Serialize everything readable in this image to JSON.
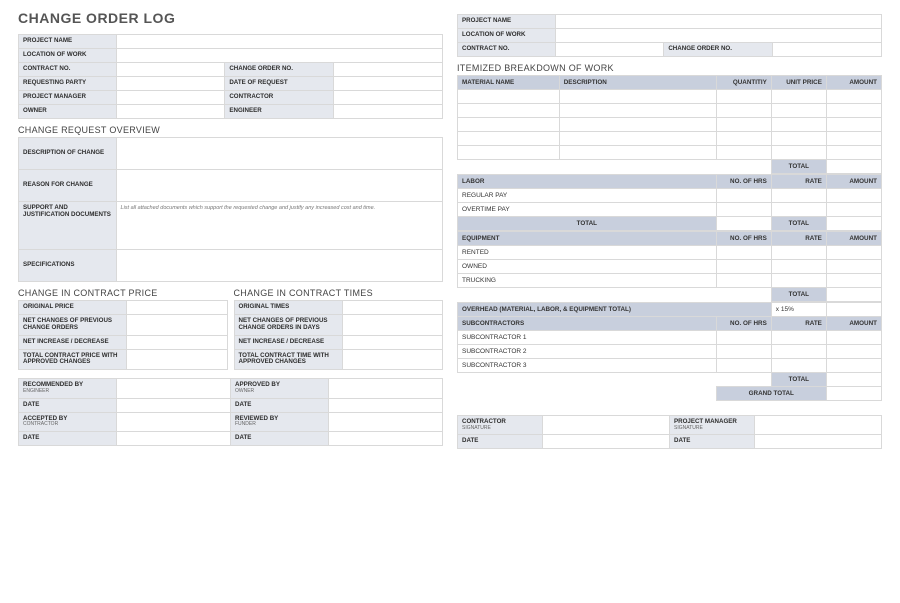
{
  "title": "CHANGE ORDER LOG",
  "left": {
    "info": {
      "project_name": "PROJECT NAME",
      "location_of_work": "LOCATION OF WORK",
      "contract_no": "CONTRACT NO.",
      "change_order_no": "CHANGE ORDER NO.",
      "requesting_party": "REQUESTING PARTY",
      "date_of_request": "DATE OF REQUEST",
      "project_manager": "PROJECT MANAGER",
      "contractor": "CONTRACTOR",
      "owner": "OWNER",
      "engineer": "ENGINEER"
    },
    "overview_title": "CHANGE REQUEST OVERVIEW",
    "overview": {
      "description": "DESCRIPTION OF CHANGE",
      "reason": "REASON FOR CHANGE",
      "support": "SUPPORT AND JUSTIFICATION DOCUMENTS",
      "support_note": "List all attached documents which support the requested change and justify any increased cost and time.",
      "specs": "SPECIFICATIONS"
    },
    "price_title": "CHANGE IN CONTRACT PRICE",
    "times_title": "CHANGE IN CONTRACT TIMES",
    "price": {
      "original": "ORIGINAL PRICE",
      "net_changes": "NET CHANGES OF PREVIOUS CHANGE ORDERS",
      "net_inc": "NET INCREASE / DECREASE",
      "total": "TOTAL CONTRACT PRICE WITH APPROVED CHANGES"
    },
    "times": {
      "original": "ORIGINAL TIMES",
      "net_changes": "NET CHANGES OF PREVIOUS CHANGE ORDERS IN DAYS",
      "net_inc": "NET INCREASE / DECREASE",
      "total": "TOTAL CONTRACT TIME WITH APPROVED CHANGES"
    },
    "sign": {
      "recommended": "RECOMMENDED BY",
      "recommended_sub": "ENGINEER",
      "approved": "APPROVED BY",
      "approved_sub": "OWNER",
      "accepted": "ACCEPTED BY",
      "accepted_sub": "CONTRACTOR",
      "reviewed": "REVIEWED BY",
      "reviewed_sub": "FUNDER",
      "date": "DATE"
    }
  },
  "right": {
    "info": {
      "project_name": "PROJECT NAME",
      "location_of_work": "LOCATION OF WORK",
      "contract_no": "CONTRACT NO.",
      "change_order_no": "CHANGE ORDER NO."
    },
    "breakdown_title": "ITEMIZED BREAKDOWN OF WORK",
    "cols": {
      "material": "MATERIAL NAME",
      "description": "DESCRIPTION",
      "quantity": "QUANTITIY",
      "unit_price": "UNIT PRICE",
      "amount": "AMOUNT",
      "no_hrs": "NO. OF HRS",
      "rate": "RATE"
    },
    "labor": {
      "title": "LABOR",
      "regular": "REGULAR PAY",
      "overtime": "OVERTIME PAY"
    },
    "equipment": {
      "title": "EQUIPMENT",
      "rented": "RENTED",
      "owned": "OWNED",
      "trucking": "TRUCKING"
    },
    "overhead": "OVERHEAD (MATERIAL, LABOR, & EQUIPMENT TOTAL)",
    "overhead_rate": "x 15%",
    "subs": {
      "title": "SUBCONTRACTORS",
      "s1": "SUBCONTRACTOR 1",
      "s2": "SUBCONTRACTOR 2",
      "s3": "SUBCONTRACTOR 3"
    },
    "total": "TOTAL",
    "grand_total": "GRAND TOTAL",
    "sign": {
      "contractor": "CONTRACTOR",
      "pm": "PROJECT MANAGER",
      "sig": "SIGNATURE",
      "date": "DATE"
    }
  }
}
